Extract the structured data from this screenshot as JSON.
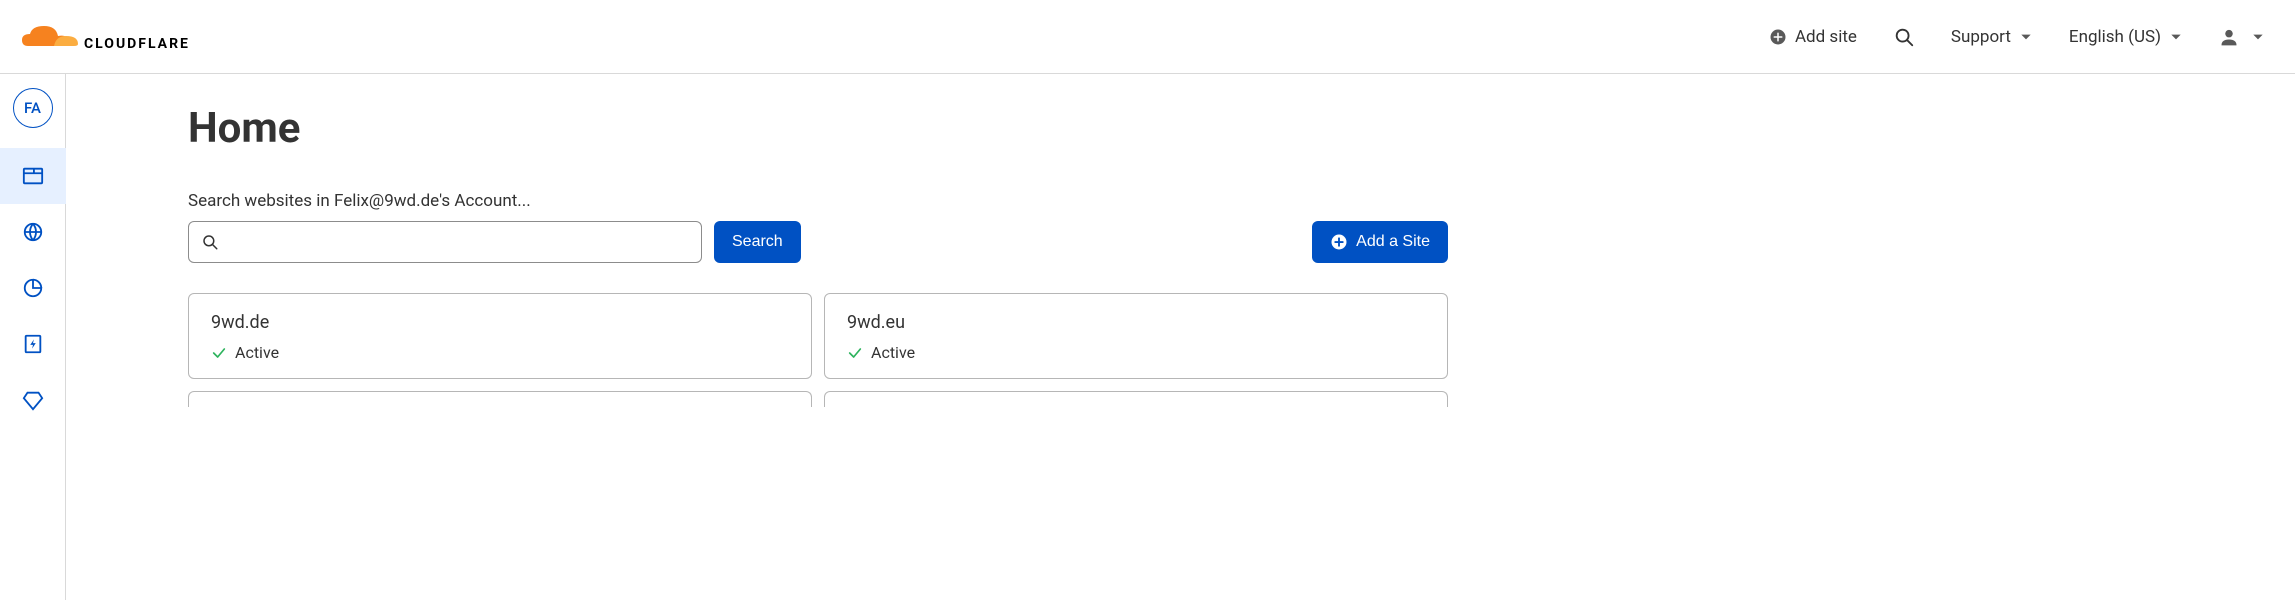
{
  "header": {
    "brand": "CLOUDFLARE",
    "add_site_label": "Add site",
    "support_label": "Support",
    "language_label": "English (US)"
  },
  "sidebar": {
    "avatar_initials": "FA"
  },
  "main": {
    "title": "Home",
    "search_label": "Search websites in Felix@9wd.de's Account...",
    "search_button": "Search",
    "add_site_button": "Add a Site"
  },
  "sites": [
    {
      "domain": "9wd.de",
      "status": "Active"
    },
    {
      "domain": "9wd.eu",
      "status": "Active"
    }
  ],
  "colors": {
    "accent": "#0051c3",
    "brand_orange": "#f6821f",
    "success": "#2db35d"
  }
}
